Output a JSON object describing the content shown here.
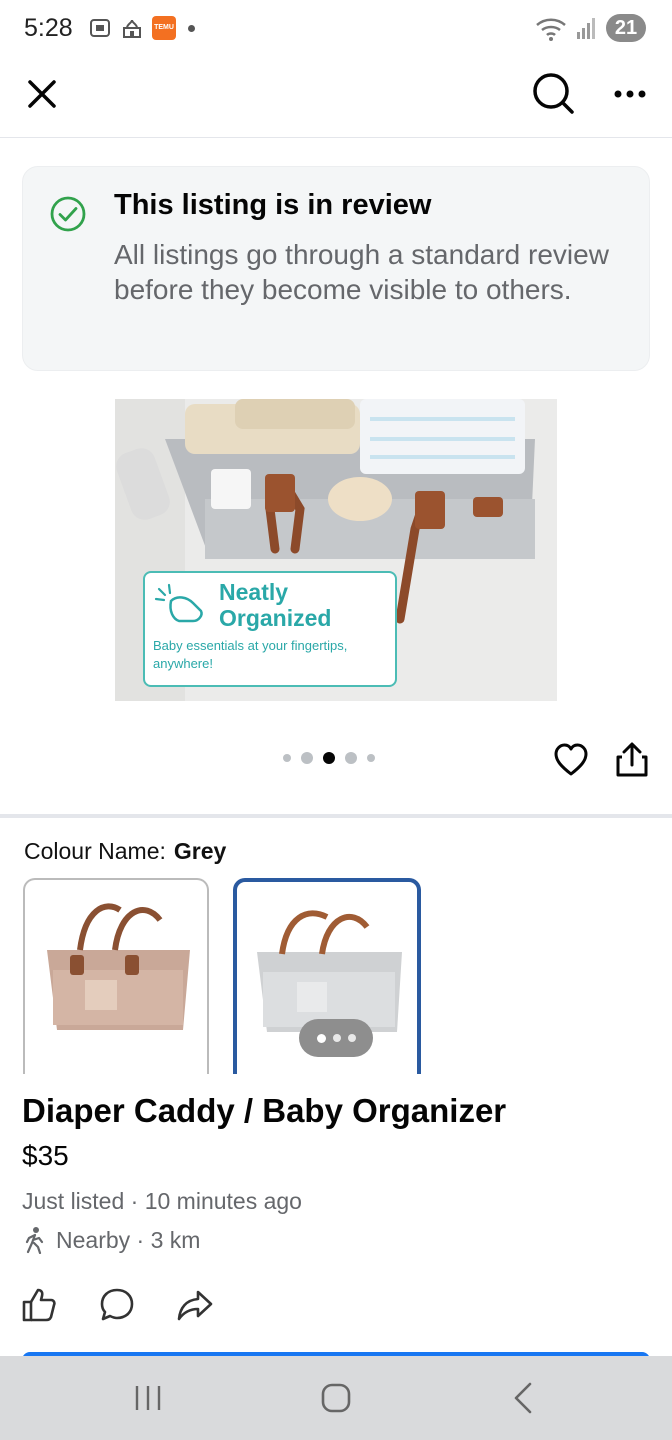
{
  "status_bar": {
    "time": "5:28",
    "temu_label": "TEMU",
    "battery": "21"
  },
  "review_banner": {
    "title": "This listing is in review",
    "text": "All listings go through a standard review before they become visible to others."
  },
  "main_image": {
    "caption_title": "Neatly Organized",
    "caption_subtitle": "Baby essentials at your fingertips, anywhere!"
  },
  "carousel": {
    "total": 5,
    "active_index": 2
  },
  "colour": {
    "label": "Colour Name:",
    "value": "Grey"
  },
  "listing": {
    "title": "Diaper Caddy / Baby Organizer",
    "price": "$35",
    "meta": "Just listed · 10 minutes ago",
    "location": "Nearby · 3 km"
  },
  "colors": {
    "accent_blue": "#1877f2",
    "check_green": "#31a24c",
    "teal": "#2aa8a8"
  }
}
